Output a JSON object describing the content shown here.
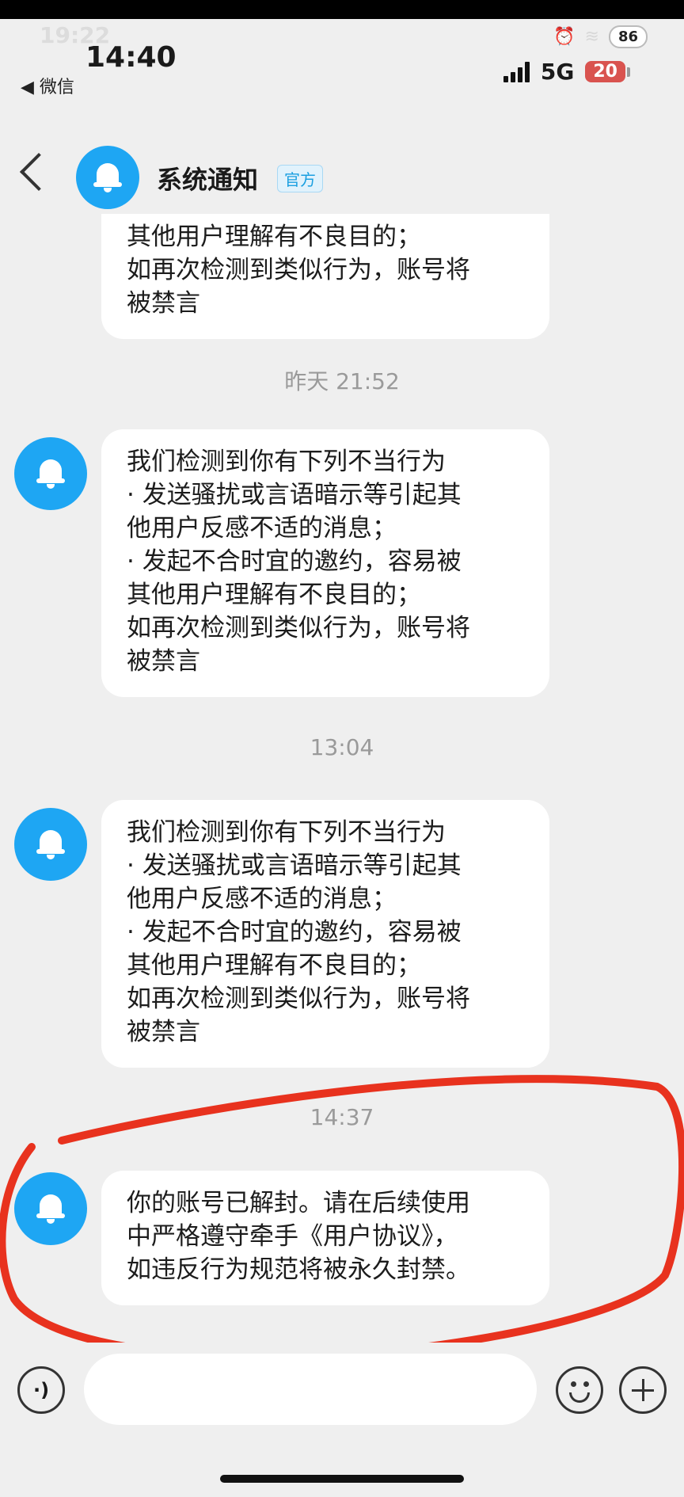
{
  "outer_status": {
    "time": "19:22",
    "battery": "86"
  },
  "status_bar": {
    "time": "14:40",
    "back_app": "◀ 微信",
    "network": "5G",
    "battery": "20"
  },
  "header": {
    "title": "系统通知",
    "badge": "官方"
  },
  "messages": [
    {
      "type": "bubble",
      "lines": [
        "其他用户理解有不良目的；",
        "如再次检测到类似行为，账号将",
        "被禁言"
      ]
    },
    {
      "type": "timestamp",
      "text": "昨天 21:52"
    },
    {
      "type": "bubble",
      "lines": [
        "我们检测到你有下列不当行为",
        "· 发送骚扰或言语暗示等引起其",
        "他用户反感不适的消息；",
        "· 发起不合时宜的邀约，容易被",
        "其他用户理解有不良目的；",
        "如再次检测到类似行为，账号将",
        "被禁言"
      ]
    },
    {
      "type": "timestamp",
      "text": "13:04"
    },
    {
      "type": "bubble",
      "lines": [
        "我们检测到你有下列不当行为",
        "· 发送骚扰或言语暗示等引起其",
        "他用户反感不适的消息；",
        "· 发起不合时宜的邀约，容易被",
        "其他用户理解有不良目的；",
        "如再次检测到类似行为，账号将",
        "被禁言"
      ]
    },
    {
      "type": "timestamp",
      "text": "14:37"
    },
    {
      "type": "bubble",
      "lines": [
        "你的账号已解封。请在后续使用",
        "中严格遵守牵手《用户协议》，",
        "如违反行为规范将被永久封禁。"
      ]
    }
  ],
  "input_bar": {
    "placeholder": "",
    "icons": [
      "voice-icon",
      "emoji-icon",
      "plus-icon"
    ]
  },
  "colors": {
    "accent": "#1ea6f3",
    "annotation": "#e8321e",
    "background": "#efefef"
  }
}
